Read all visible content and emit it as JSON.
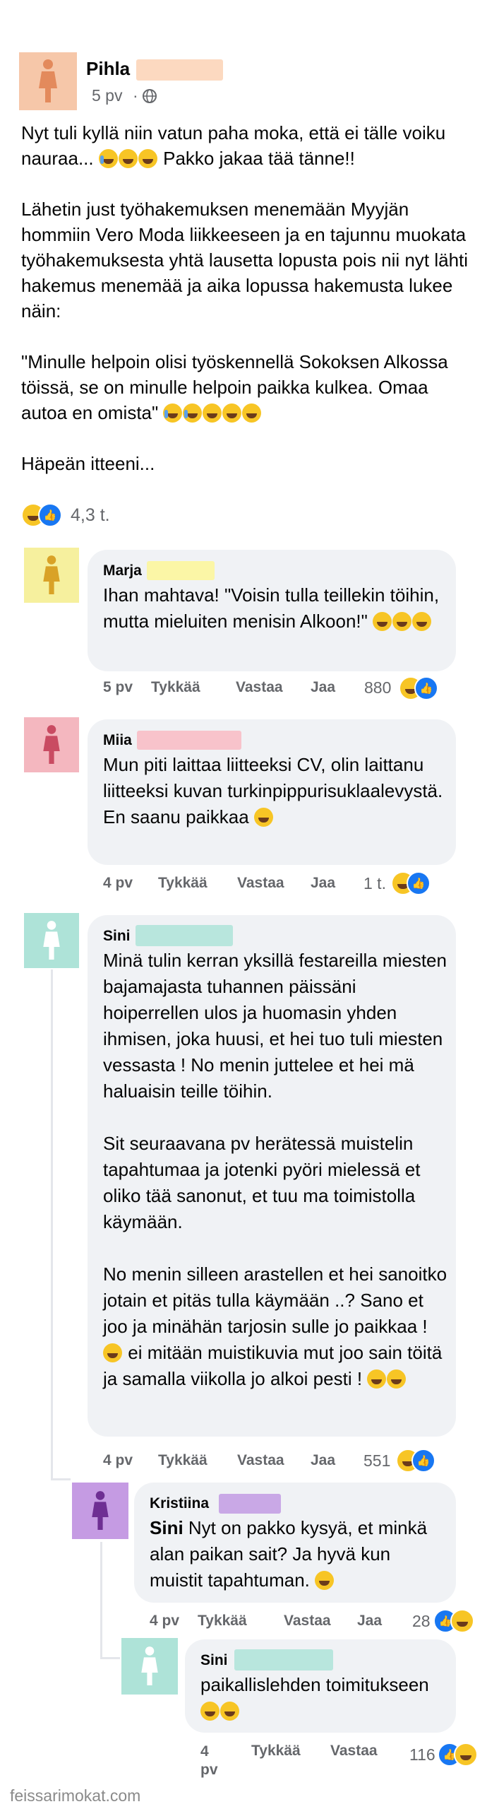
{
  "post": {
    "author": "Pihla",
    "time": "5 pv",
    "privacy_icon": "globe-icon",
    "paragraphs": [
      "Nyt tuli kyllä niin vatun paha moka, että ei tälle voiku nauraa...",
      "Pakko jakaa tää tänne!!",
      "Lähetin just työhakemuksen menemään Myyjän hommiin Vero Moda liikkeeseen ja en tajunnu muokata työhakemuksesta yhtä lausetta lopusta pois nii nyt lähti hakemus menemää ja aika lopussa hakemusta lukee näin:",
      "\"Minulle helpoin olisi työskennellä Sokoksen Alkossa töissä, se on minulle helpoin paikka kulkea. Omaa autoa en omista\"",
      "Häpeän itteeni..."
    ],
    "reaction_count": "4,3 t."
  },
  "labels": {
    "like": "Tykkää",
    "reply": "Vastaa",
    "share": "Jaa"
  },
  "comments": [
    {
      "author": "Marja",
      "text": "Ihan mahtava! \"Voisin tulla teillekin töihin, mutta mieluiten menisin Alkoon!\"",
      "time": "5 pv",
      "count": "880"
    },
    {
      "author": "Miia",
      "text": "Mun piti laittaa liitteeksi CV, olin laittanu liitteeksi kuvan turkinpippurisuklaalevystä. En saanu paikkaa",
      "time": "4 pv",
      "count": "1 t."
    },
    {
      "author": "Sini",
      "paragraphs": [
        "Minä tulin kerran yksillä festareilla miesten bajamajasta tuhannen päissäni hoiperrellen ulos ja huomasin yhden ihmisen, joka huusi, et hei tuo tuli miesten vessasta ! No menin juttelee et hei mä haluaisin teille töihin.",
        "Sit seuraavana pv herätessä muistelin tapahtumaa ja jotenki pyöri mielessä et oliko tää sanonut, et tuu ma toimistolla käymään.",
        "No menin silleen arastellen et hei sanoitko jotain et pitäs tulla käymään ..? Sano et joo ja minähän tarjosin sulle jo paikkaa !",
        "ei mitään muistikuvia mut joo sain töitä ja samalla viikolla jo alkoi pesti !"
      ],
      "time": "4 pv",
      "count": "551"
    },
    {
      "author": "Kristiina",
      "mention": "Sini",
      "text": "Nyt on pakko kysyä, et minkä alan paikan sait? Ja hyvä kun muistit tapahtuman.",
      "time": "4 pv",
      "count": "28"
    },
    {
      "author": "Sini",
      "text": "paikallislehden toimitukseen",
      "time": "4 pv",
      "count": "116"
    }
  ],
  "watermark": "feissarimokat.com",
  "colors": {
    "redact_pihla": "#fcd9c0",
    "redact_marja": "#fbf6a6",
    "redact_miia": "#f8c3cb",
    "redact_sini": "#b8e6dd",
    "redact_kristiina": "#c9a8e6",
    "avatar_pihla": "#f6c7a9",
    "avatar_marja": "#f6f09e",
    "avatar_miia": "#f4b7bf",
    "avatar_sini": "#aee3d8",
    "avatar_kristiina": "#c59be3",
    "like_blue": "#1877f2",
    "haha_yellow": "#f7c525"
  }
}
